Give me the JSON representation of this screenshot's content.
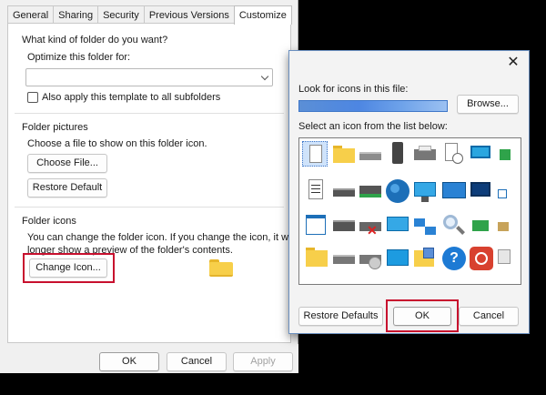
{
  "properties": {
    "tabs": [
      "General",
      "Sharing",
      "Security",
      "Previous Versions",
      "Customize"
    ],
    "active_tab": "Customize",
    "question": "What kind of folder do you want?",
    "optimize_label": "Optimize this folder for:",
    "optimize_value": "",
    "apply_subfolders": "Also apply this template to all subfolders",
    "folder_pictures_heading": "Folder pictures",
    "folder_pictures_desc": "Choose a file to show on this folder icon.",
    "choose_file": "Choose File...",
    "restore_default": "Restore Default",
    "folder_icons_heading": "Folder icons",
    "folder_icons_desc_line1": "You can change the folder icon. If you change the icon, it will no",
    "folder_icons_desc_line2": "longer show a preview of the folder's contents.",
    "change_icon": "Change Icon...",
    "ok": "OK",
    "cancel": "Cancel",
    "apply": "Apply"
  },
  "change_icon_dialog": {
    "close_glyph": "✕",
    "look_for_label": "Look for icons in this file:",
    "browse": "Browse...",
    "select_label": "Select an icon from the list below:",
    "restore_defaults": "Restore Defaults",
    "ok": "OK",
    "cancel": "Cancel"
  },
  "colors": {
    "highlight_red": "#c8102e",
    "selection_blue": "#3f77c8",
    "folder_yellow": "#f7cf4a"
  }
}
